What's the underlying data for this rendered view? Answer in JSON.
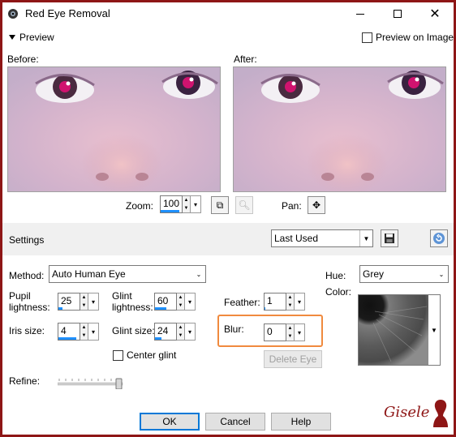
{
  "window": {
    "title": "Red Eye Removal"
  },
  "preview": {
    "toggle_label": "Preview",
    "on_image_label": "Preview on Image",
    "on_image_checked": false,
    "before_label": "Before:",
    "after_label": "After:",
    "zoom_label": "Zoom:",
    "zoom_value": "100",
    "pan_label": "Pan:"
  },
  "settings": {
    "label": "Settings",
    "preset": "Last Used"
  },
  "controls": {
    "method_label": "Method:",
    "method_value": "Auto Human Eye",
    "pupil_label": "Pupil\nlightness:",
    "pupil_line1": "Pupil",
    "pupil_line2": "lightness:",
    "pupil_value": "25",
    "glint_light_line1": "Glint",
    "glint_light_line2": "lightness:",
    "glint_light_value": "60",
    "feather_label": "Feather:",
    "feather_value": "1",
    "iris_label": "Iris size:",
    "iris_value": "4",
    "glint_size_label": "Glint size:",
    "glint_size_value": "24",
    "blur_label": "Blur:",
    "blur_value": "0",
    "center_glint_label": "Center glint",
    "center_glint_checked": false,
    "delete_eye_label": "Delete Eye",
    "refine_label": "Refine:",
    "hue_label": "Hue:",
    "hue_value": "Grey",
    "color_label": "Color:"
  },
  "buttons": {
    "ok": "OK",
    "cancel": "Cancel",
    "help": "Help"
  },
  "watermark": "Gisele",
  "colors": {
    "border": "#8e1616",
    "highlight": "#f08a3e",
    "accent": "#0078d7"
  },
  "levels": {
    "zoom_fill": 0.9,
    "pupil_fill": 0.2,
    "glint_light_fill": 0.55,
    "feather_fill": 0.05,
    "iris_fill": 0.85,
    "glint_size_fill": 0.3,
    "blur_fill": 0.0,
    "refine_level": 1.0
  }
}
